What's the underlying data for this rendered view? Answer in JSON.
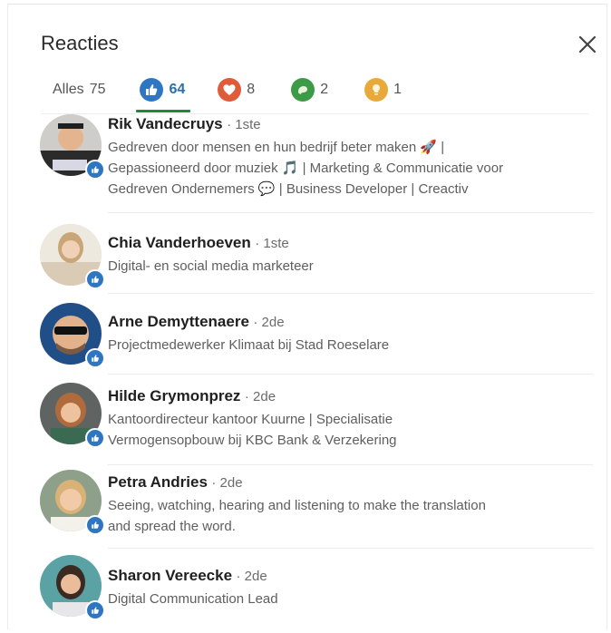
{
  "modal": {
    "title": "Reacties"
  },
  "tabs": [
    {
      "label": "Alles",
      "count": "75",
      "icon": "none"
    },
    {
      "label": "",
      "count": "64",
      "icon": "like-icon",
      "color": "#2e76c2"
    },
    {
      "label": "",
      "count": "8",
      "icon": "love-icon",
      "color": "#df5b3a"
    },
    {
      "label": "",
      "count": "2",
      "icon": "support-icon",
      "color": "#3d9a46"
    },
    {
      "label": "",
      "count": "1",
      "icon": "insightful-icon",
      "color": "#e8a93a"
    }
  ],
  "people": [
    {
      "name": "Rik Vandecruys",
      "degree": "· 1ste",
      "headline": [
        "Gedreven door mensen en hun bedrijf beter maken 🚀 |",
        "Gepassioneerd door muziek 🎵 | Marketing & Communicatie voor",
        "Gedreven Ondernemers 💬 | Business Developer | Creactiv"
      ]
    },
    {
      "name": "Chia Vanderhoeven",
      "degree": "· 1ste",
      "headline": [
        "Digital- en social media marketeer"
      ]
    },
    {
      "name": "Arne Demyttenaere",
      "degree": "· 2de",
      "headline": [
        "Projectmedewerker Klimaat bij Stad Roeselare"
      ]
    },
    {
      "name": "Hilde Grymonprez",
      "degree": "· 2de",
      "headline": [
        "Kantoordirecteur kantoor Kuurne | Specialisatie",
        "Vermogensopbouw bij KBC Bank & Verzekering"
      ]
    },
    {
      "name": "Petra Andries",
      "degree": "· 2de",
      "headline": [
        "Seeing, watching, hearing and listening to make the translation",
        "and spread the word."
      ]
    },
    {
      "name": "Sharon Vereecke",
      "degree": "· 2de",
      "headline": [
        "Digital Communication Lead"
      ]
    }
  ]
}
